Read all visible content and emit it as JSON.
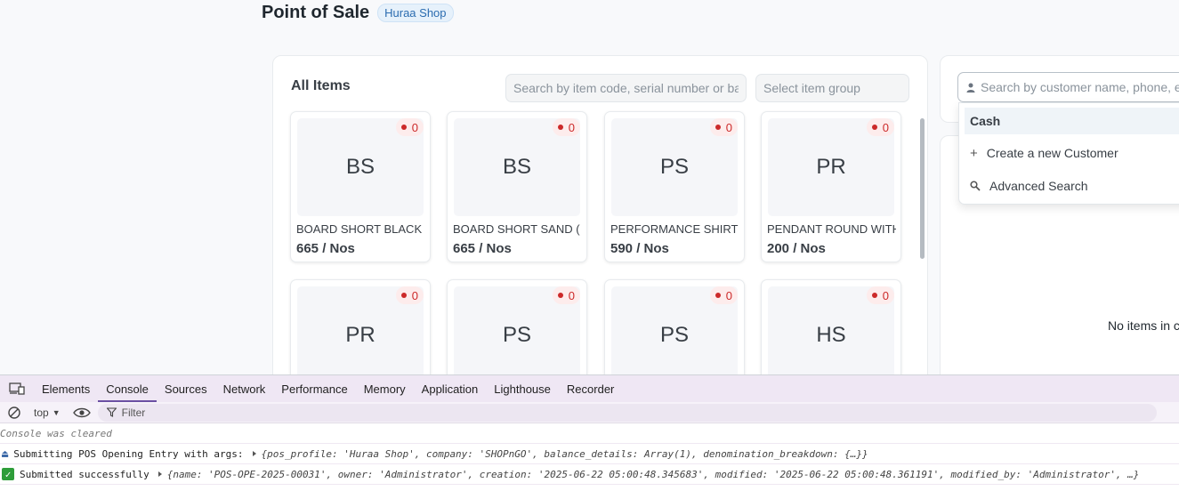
{
  "header": {
    "title": "Point of Sale",
    "shop": "Huraa Shop"
  },
  "items_panel": {
    "title": "All Items",
    "search_placeholder": "Search by item code, serial number or barcode",
    "group_placeholder": "Select item group",
    "items": [
      {
        "abbr": "BS",
        "name": "BOARD SHORT BLACK",
        "price": "665 / Nos",
        "stock": "0"
      },
      {
        "abbr": "BS",
        "name": "BOARD SHORT SAND (",
        "price": "665 / Nos",
        "stock": "0"
      },
      {
        "abbr": "PS",
        "name": "PERFORMANCE SHIRT",
        "price": "590 / Nos",
        "stock": "0"
      },
      {
        "abbr": "PR",
        "name": "PENDANT ROUND WITH",
        "price": "200 / Nos",
        "stock": "0"
      },
      {
        "abbr": "PR",
        "stock": "0"
      },
      {
        "abbr": "PS",
        "stock": "0"
      },
      {
        "abbr": "PS",
        "stock": "0"
      },
      {
        "abbr": "HS",
        "stock": "0"
      }
    ]
  },
  "customer": {
    "search_placeholder": "Search by customer name, phone, email",
    "dropdown": {
      "selected": "Cash",
      "create": "Create a new Customer",
      "advanced": "Advanced Search"
    }
  },
  "cart": {
    "empty_text": "No items in cart"
  },
  "devtools": {
    "tabs": [
      "Elements",
      "Console",
      "Sources",
      "Network",
      "Performance",
      "Memory",
      "Application",
      "Lighthouse",
      "Recorder"
    ],
    "active_tab": "Console",
    "context": "top",
    "filter_placeholder": "Filter",
    "cleared": "Console was cleared",
    "line1_msg": "Submitting POS Opening Entry with args:",
    "line1_obj": "{pos_profile: 'Huraa Shop', company: 'SHOPnGO', balance_details: Array(1), denomination_breakdown: {…}}",
    "line2_msg": "Submitted successfully",
    "line2_obj": "{name: 'POS-OPE-2025-00031', owner: 'Administrator', creation: '2025-06-22 05:00:48.345683', modified: '2025-06-22 05:00:48.361191', modified_by: 'Administrator', …}"
  }
}
